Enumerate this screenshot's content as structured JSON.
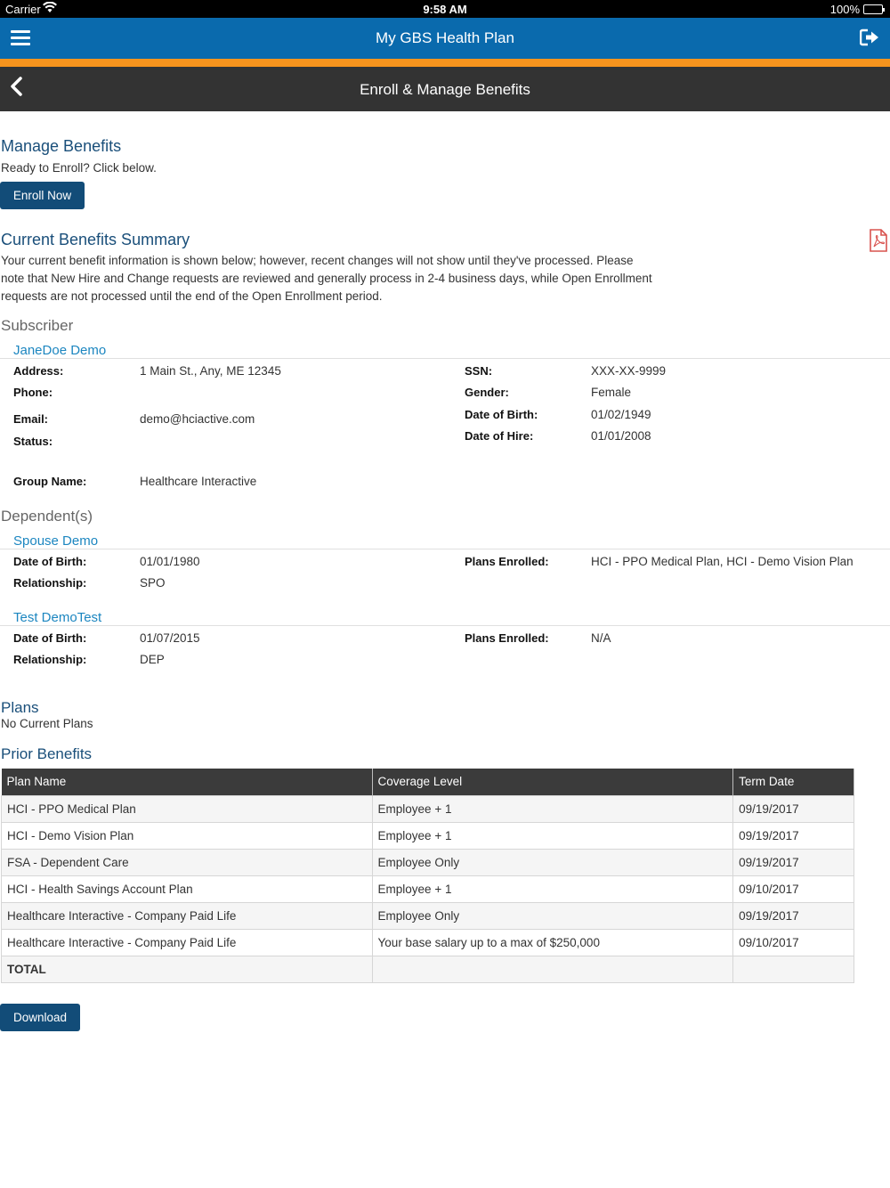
{
  "status_bar": {
    "carrier": "Carrier",
    "time": "9:58 AM",
    "battery": "100%"
  },
  "app_bar": {
    "title": "My GBS Health Plan"
  },
  "sub_bar": {
    "title": "Enroll & Manage Benefits"
  },
  "manage": {
    "heading": "Manage Benefits",
    "prompt": "Ready to Enroll? Click below.",
    "enroll_button": "Enroll Now"
  },
  "summary": {
    "heading": "Current Benefits Summary",
    "line1": "Your current benefit information is shown below; however, recent changes will not show until they've processed. Please",
    "line2": "note that New Hire and Change requests are reviewed and generally process in 2-4 business days, while Open Enrollment",
    "line3": "requests are not processed until the end of the Open Enrollment period."
  },
  "subscriber": {
    "section_title": "Subscriber",
    "name": "JaneDoe Demo",
    "address_label": "Address:",
    "address": "1 Main St., Any, ME 12345",
    "phone_label": "Phone:",
    "email_label": "Email:",
    "email": "demo@hciactive.com",
    "status_label": "Status:",
    "ssn_label": "SSN:",
    "ssn": "XXX-XX-9999",
    "gender_label": "Gender:",
    "gender": "Female",
    "dob_label": "Date of Birth:",
    "dob": "01/02/1949",
    "doh_label": "Date of Hire:",
    "doh": "01/01/2008",
    "group_label": "Group Name:",
    "group": "Healthcare Interactive"
  },
  "dependents": {
    "section_title": "Dependent(s)",
    "items": [
      {
        "name": "Spouse Demo",
        "dob_label": "Date of Birth:",
        "dob": "01/01/1980",
        "rel_label": "Relationship:",
        "rel": "SPO",
        "plans_label": "Plans Enrolled:",
        "plans": "HCI - PPO Medical Plan, HCI - Demo Vision Plan"
      },
      {
        "name": "Test DemoTest",
        "dob_label": "Date of Birth:",
        "dob": "01/07/2015",
        "rel_label": "Relationship:",
        "rel": "DEP",
        "plans_label": "Plans Enrolled:",
        "plans": "N/A"
      }
    ]
  },
  "plans": {
    "heading": "Plans",
    "empty": "No Current Plans"
  },
  "prior": {
    "heading": "Prior Benefits",
    "columns": [
      "Plan Name",
      "Coverage Level",
      "Term Date"
    ],
    "rows": [
      [
        "HCI - PPO Medical Plan",
        "Employee + 1",
        "09/19/2017"
      ],
      [
        "HCI - Demo Vision Plan",
        "Employee + 1",
        "09/19/2017"
      ],
      [
        "FSA - Dependent Care",
        "Employee Only",
        "09/19/2017"
      ],
      [
        "HCI - Health Savings Account Plan",
        "Employee + 1",
        "09/10/2017"
      ],
      [
        "Healthcare Interactive - Company Paid Life",
        "Employee Only",
        "09/19/2017"
      ],
      [
        "Healthcare Interactive - Company Paid Life",
        "Your base salary up to a max of $250,000",
        "09/10/2017"
      ]
    ],
    "total_label": "TOTAL"
  },
  "download_button": "Download",
  "icons": {
    "menu": "hamburger-menu-icon",
    "logout": "logout-icon",
    "back": "chevron-left-icon",
    "pdf": "pdf-file-icon",
    "wifi": "wifi-icon",
    "battery": "battery-icon"
  },
  "colors": {
    "app_bar": "#0a6aad",
    "stripe": "#f7941d",
    "sub_bar": "#333333",
    "heading": "#1a4f7a",
    "link": "#1c86c0",
    "button": "#124c78"
  }
}
